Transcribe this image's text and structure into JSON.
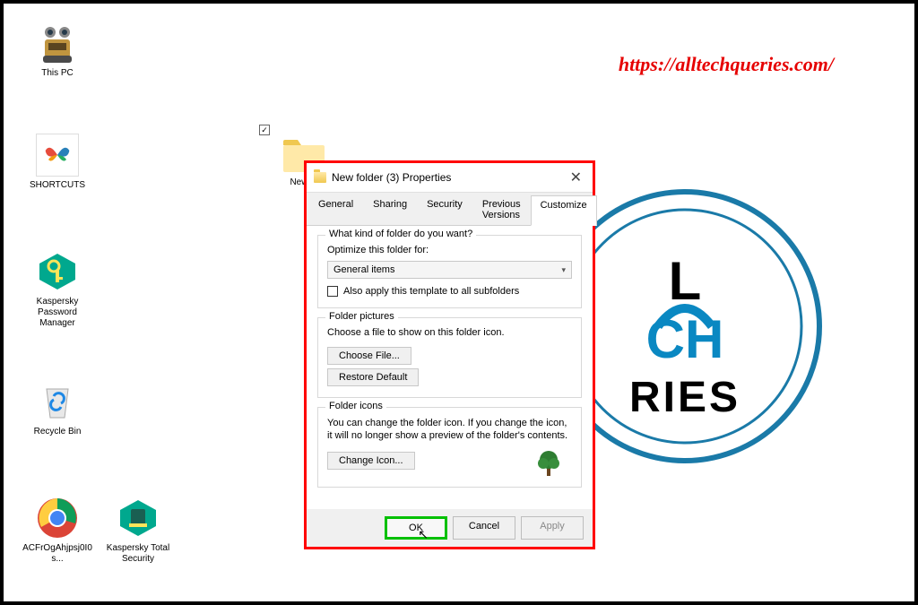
{
  "watermark_url": "https://alltechqueries.com/",
  "desktop_icons": {
    "this_pc": "This PC",
    "shortcuts": "SHORTCUTS",
    "kaspersky_pm": "Kaspersky Password Manager",
    "recycle_bin": "Recycle Bin",
    "chrome": "ACFrOgAhjpsj0I0s...",
    "kaspersky_ts": "Kaspersky Total Security"
  },
  "bg_folder_label": "New fo",
  "dialog": {
    "title": "New folder (3) Properties",
    "tabs": {
      "general": "General",
      "sharing": "Sharing",
      "security": "Security",
      "previous": "Previous Versions",
      "customize": "Customize"
    },
    "section1": {
      "legend": "What kind of folder do you want?",
      "optimize_label": "Optimize this folder for:",
      "dropdown_value": "General items",
      "also_apply": "Also apply this template to all subfolders"
    },
    "section2": {
      "legend": "Folder pictures",
      "choose_text": "Choose a file to show on this folder icon.",
      "choose_file_btn": "Choose File...",
      "restore_btn": "Restore Default"
    },
    "section3": {
      "legend": "Folder icons",
      "desc": "You can change the folder icon. If you change the icon, it will no longer show a preview of the folder's contents.",
      "change_icon_btn": "Change Icon..."
    },
    "footer": {
      "ok": "OK",
      "cancel": "Cancel",
      "apply": "Apply"
    }
  }
}
